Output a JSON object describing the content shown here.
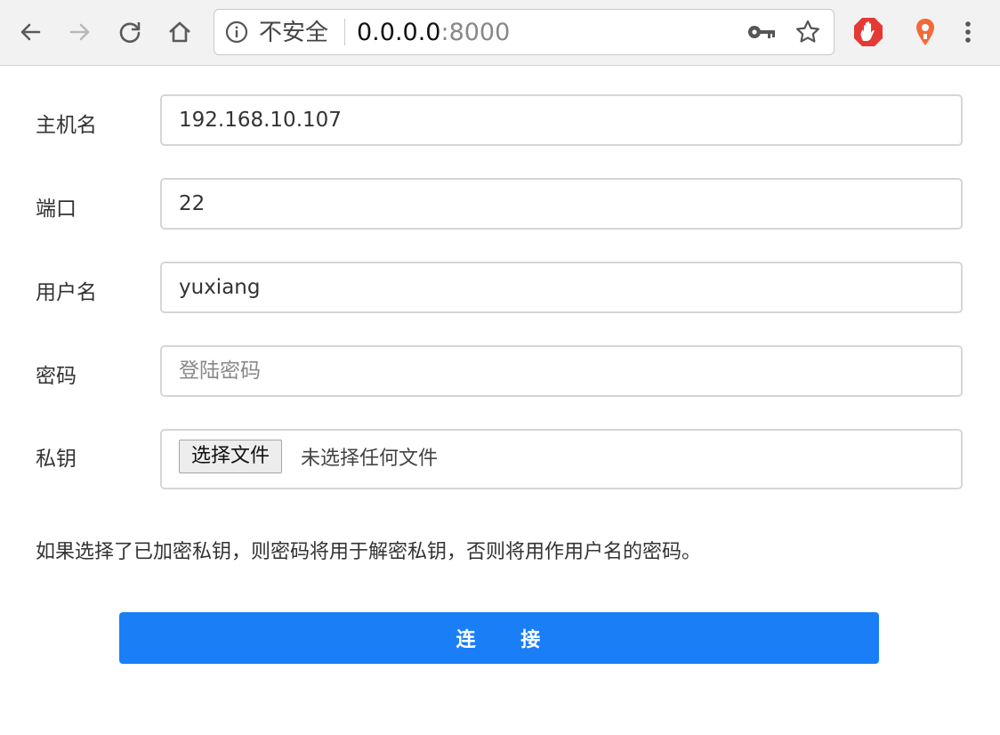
{
  "browser": {
    "security_label": "不安全",
    "url_host": "0.0.0.0",
    "url_port": ":8000",
    "icons": [
      "back-arrow-icon",
      "forward-arrow-icon",
      "reload-icon",
      "home-icon",
      "info-icon",
      "key-icon",
      "star-icon",
      "adblock-icon",
      "location-pin-icon",
      "kebab-menu-icon"
    ]
  },
  "form": {
    "hostname": {
      "label": "主机名",
      "value": "192.168.10.107"
    },
    "port": {
      "label": "端口",
      "value": "22"
    },
    "username": {
      "label": "用户名",
      "value": "yuxiang"
    },
    "password": {
      "label": "密码",
      "placeholder": "登陆密码",
      "value": ""
    },
    "privatekey": {
      "label": "私钥",
      "button": "选择文件",
      "status": "未选择任何文件"
    },
    "hint": "如果选择了已加密私钥，则密码将用于解密私钥，否则将用作用户名的密码。",
    "submit": "连　　接"
  },
  "colors": {
    "accent": "#1a7ff7",
    "adblock": "#e53935",
    "pin": "#f26a3a"
  }
}
